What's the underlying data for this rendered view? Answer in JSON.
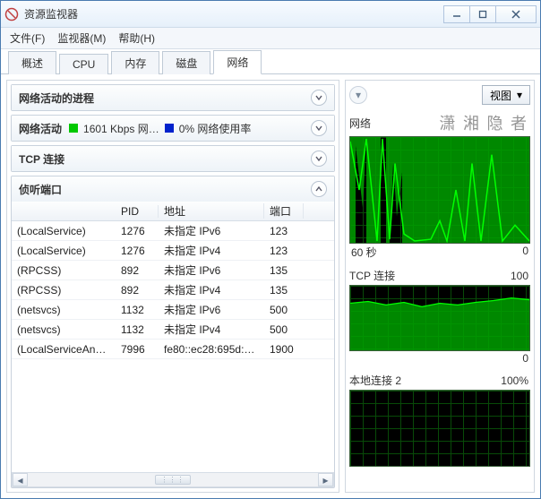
{
  "window": {
    "title": "资源监视器"
  },
  "menu": {
    "file": "文件(F)",
    "monitor": "监视器(M)",
    "help": "帮助(H)"
  },
  "tabs": {
    "overview": "概述",
    "cpu": "CPU",
    "memory": "内存",
    "disk": "磁盘",
    "network": "网络"
  },
  "panels": {
    "procs": {
      "title": "网络活动的进程"
    },
    "activity": {
      "title": "网络活动",
      "rate_label": "1601 Kbps 网…",
      "usage_label": "0% 网络使用率",
      "color1": "#00c800",
      "color2": "#0022cc"
    },
    "tcp": {
      "title": "TCP 连接"
    },
    "listen": {
      "title": "侦听端口",
      "headers": {
        "name": "",
        "pid": "PID",
        "addr": "地址",
        "port": "端口"
      },
      "rows": [
        {
          "name": "(LocalService)",
          "pid": "1276",
          "addr": "未指定 IPv6",
          "port": "123"
        },
        {
          "name": "(LocalService)",
          "pid": "1276",
          "addr": "未指定 IPv4",
          "port": "123"
        },
        {
          "name": "(RPCSS)",
          "pid": "892",
          "addr": "未指定 IPv6",
          "port": "135"
        },
        {
          "name": "(RPCSS)",
          "pid": "892",
          "addr": "未指定 IPv4",
          "port": "135"
        },
        {
          "name": "(netsvcs)",
          "pid": "1132",
          "addr": "未指定 IPv6",
          "port": "500"
        },
        {
          "name": "(netsvcs)",
          "pid": "1132",
          "addr": "未指定 IPv4",
          "port": "500"
        },
        {
          "name": "(LocalServiceAnd…",
          "pid": "7996",
          "addr": "fe80::ec28:695d:…",
          "port": "1900"
        }
      ]
    }
  },
  "rightpane": {
    "view_label": "视图",
    "watermark": "潇 湘 隐 者",
    "graphs": {
      "g1": {
        "title": "网络",
        "left": "60 秒",
        "right": "0"
      },
      "g2": {
        "title": "TCP 连接",
        "right_top": "100",
        "right": "0"
      },
      "g3": {
        "title": "本地连接 2",
        "right_top": "100%"
      }
    }
  }
}
